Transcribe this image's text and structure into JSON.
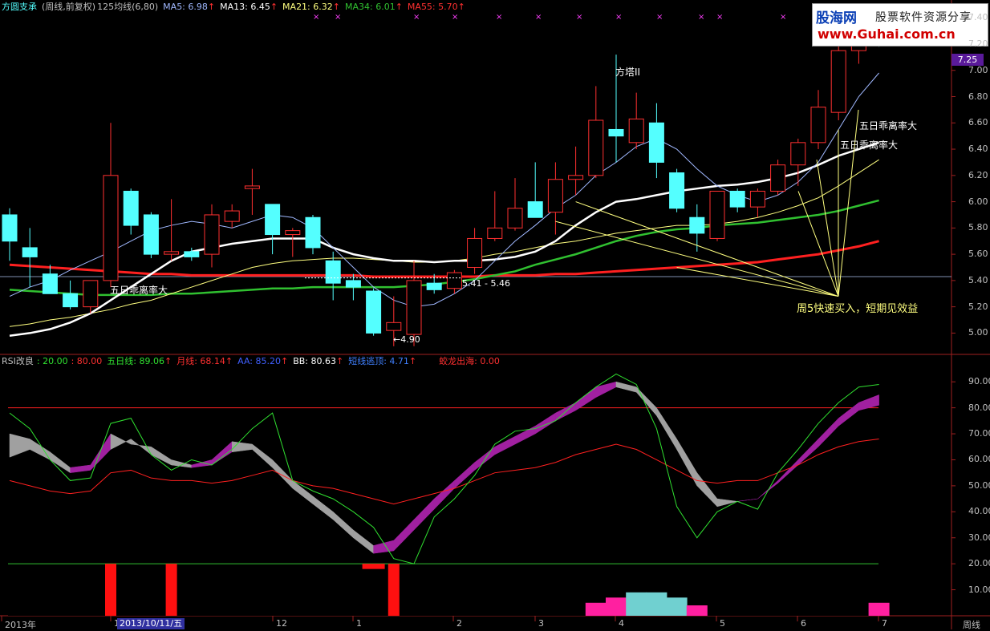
{
  "header": {
    "title": "方圆支承",
    "subtitle": "(周线,前复权)",
    "cost_line": "125均线(6,80)",
    "ma5": "MA5: 6.98",
    "ma13": "MA13: 6.45",
    "ma21": "MA21: 6.32",
    "ma34": "MA34: 6.01",
    "ma55": "MA55: 5.70"
  },
  "indicator_header": {
    "name": "RSI改良",
    "v1": ": 20.00",
    "v2": ": 80.00",
    "wuri": "五日线: 89.06",
    "yue": "月线: 68.14",
    "aa": "AA: 85.20",
    "bb": "BB: 80.63",
    "duan": "短线逃顶: 4.71",
    "jiaolong": "蛟龙出海: 0.00"
  },
  "logo": {
    "brand": "股海网",
    "slogan": "股票软件资源分享",
    "url": "www.Guhai.com.cn"
  },
  "colors": {
    "up": "#ff3030",
    "down": "#54ffff",
    "ma5": "#a0b8ff",
    "ma13": "#ffffff",
    "ma21": "#ffff80",
    "ma34": "#30c030",
    "ma55": "#ff2020"
  },
  "price_axis": [
    "7.40",
    "7.20",
    "7.00",
    "6.80",
    "6.60",
    "6.40",
    "6.20",
    "6.00",
    "5.80",
    "5.60",
    "5.40",
    "5.20",
    "5.00"
  ],
  "indicator_axis": [
    "90.00",
    "80.00",
    "70.00",
    "60.00",
    "50.00",
    "40.00",
    "30.00",
    "20.00",
    "10.00"
  ],
  "current_price": "7.25",
  "time_axis": {
    "labels": [
      "2013年",
      "1",
      "12",
      "1",
      "2",
      "3",
      "4",
      "5",
      "6",
      "7"
    ],
    "selected_date": "2013/10/11/五",
    "period": "周线"
  },
  "annotations": {
    "fangta": "方塔II",
    "wuri_left": "五日乖离率大",
    "wuri_right1": "五日乖离率大",
    "wuri_right2": "五日乖离率大",
    "low_price": "←4.90",
    "range_label": "5.41 - 5.46",
    "buy_signal": "周5快速买入，短期见效益"
  },
  "chart_data": {
    "type": "candlestick",
    "candles": [
      {
        "o": 5.9,
        "h": 5.95,
        "l": 5.55,
        "c": 5.7
      },
      {
        "o": 5.65,
        "h": 5.8,
        "l": 5.35,
        "c": 5.58
      },
      {
        "o": 5.45,
        "h": 5.52,
        "l": 5.3,
        "c": 5.3
      },
      {
        "o": 5.3,
        "h": 5.4,
        "l": 5.18,
        "c": 5.2
      },
      {
        "o": 5.2,
        "h": 5.4,
        "l": 5.15,
        "c": 5.4
      },
      {
        "o": 5.4,
        "h": 6.6,
        "l": 5.35,
        "c": 6.2
      },
      {
        "o": 6.08,
        "h": 6.1,
        "l": 5.75,
        "c": 5.82
      },
      {
        "o": 5.9,
        "h": 5.92,
        "l": 5.57,
        "c": 5.6
      },
      {
        "o": 5.6,
        "h": 6.02,
        "l": 5.55,
        "c": 5.62
      },
      {
        "o": 5.62,
        "h": 5.65,
        "l": 5.55,
        "c": 5.58
      },
      {
        "o": 5.6,
        "h": 5.98,
        "l": 5.5,
        "c": 5.9
      },
      {
        "o": 5.85,
        "h": 5.98,
        "l": 5.8,
        "c": 5.93
      },
      {
        "o": 6.1,
        "h": 6.25,
        "l": 5.9,
        "c": 6.12
      },
      {
        "o": 5.98,
        "h": 5.98,
        "l": 5.6,
        "c": 5.75
      },
      {
        "o": 5.75,
        "h": 5.8,
        "l": 5.58,
        "c": 5.78
      },
      {
        "o": 5.88,
        "h": 5.9,
        "l": 5.6,
        "c": 5.65
      },
      {
        "o": 5.55,
        "h": 5.62,
        "l": 5.25,
        "c": 5.38
      },
      {
        "o": 5.4,
        "h": 5.45,
        "l": 5.25,
        "c": 5.35
      },
      {
        "o": 5.32,
        "h": 5.34,
        "l": 4.98,
        "c": 5.0
      },
      {
        "o": 5.02,
        "h": 5.28,
        "l": 4.9,
        "c": 5.08
      },
      {
        "o": 4.99,
        "h": 5.55,
        "l": 4.9,
        "c": 5.4
      },
      {
        "o": 5.38,
        "h": 5.45,
        "l": 5.3,
        "c": 5.33
      },
      {
        "o": 5.34,
        "h": 5.48,
        "l": 5.3,
        "c": 5.46
      },
      {
        "o": 5.5,
        "h": 5.8,
        "l": 5.45,
        "c": 5.72
      },
      {
        "o": 5.72,
        "h": 6.08,
        "l": 5.7,
        "c": 5.8
      },
      {
        "o": 5.8,
        "h": 6.18,
        "l": 5.78,
        "c": 5.95
      },
      {
        "o": 6.0,
        "h": 6.3,
        "l": 5.95,
        "c": 5.88
      },
      {
        "o": 5.92,
        "h": 6.3,
        "l": 5.75,
        "c": 6.17
      },
      {
        "o": 6.17,
        "h": 6.42,
        "l": 6.05,
        "c": 6.2
      },
      {
        "o": 6.2,
        "h": 6.88,
        "l": 6.18,
        "c": 6.62
      },
      {
        "o": 6.55,
        "h": 7.12,
        "l": 6.3,
        "c": 6.5
      },
      {
        "o": 6.45,
        "h": 6.83,
        "l": 6.4,
        "c": 6.63
      },
      {
        "o": 6.6,
        "h": 6.75,
        "l": 6.18,
        "c": 6.3
      },
      {
        "o": 6.22,
        "h": 6.25,
        "l": 5.92,
        "c": 5.95
      },
      {
        "o": 5.88,
        "h": 5.98,
        "l": 5.62,
        "c": 5.76
      },
      {
        "o": 5.72,
        "h": 6.08,
        "l": 5.7,
        "c": 6.08
      },
      {
        "o": 6.08,
        "h": 6.1,
        "l": 5.92,
        "c": 5.96
      },
      {
        "o": 5.96,
        "h": 6.1,
        "l": 5.88,
        "c": 6.08
      },
      {
        "o": 6.08,
        "h": 6.32,
        "l": 6.05,
        "c": 6.28
      },
      {
        "o": 6.28,
        "h": 6.48,
        "l": 6.12,
        "c": 6.45
      },
      {
        "o": 6.45,
        "h": 6.85,
        "l": 6.4,
        "c": 6.72
      },
      {
        "o": 6.68,
        "h": 7.28,
        "l": 6.62,
        "c": 7.15
      },
      {
        "o": 7.15,
        "h": 7.42,
        "l": 7.05,
        "c": 7.4
      },
      {
        "o": 7.32,
        "h": 7.5,
        "l": 7.18,
        "c": 7.2
      }
    ],
    "ma5": [
      5.28,
      5.35,
      5.4,
      5.48,
      5.55,
      5.62,
      5.7,
      5.78,
      5.82,
      5.85,
      5.83,
      5.8,
      5.85,
      5.9,
      5.88,
      5.8,
      5.65,
      5.5,
      5.35,
      5.25,
      5.2,
      5.22,
      5.3,
      5.4,
      5.55,
      5.7,
      5.82,
      5.95,
      6.05,
      6.2,
      6.3,
      6.42,
      6.48,
      6.4,
      6.25,
      6.12,
      6.05,
      6.0,
      6.05,
      6.15,
      6.3,
      6.55,
      6.8,
      6.98
    ],
    "ma13": [
      4.98,
      5.0,
      5.03,
      5.08,
      5.15,
      5.25,
      5.35,
      5.45,
      5.55,
      5.62,
      5.65,
      5.68,
      5.7,
      5.72,
      5.72,
      5.72,
      5.65,
      5.6,
      5.57,
      5.55,
      5.55,
      5.54,
      5.55,
      5.55,
      5.56,
      5.58,
      5.62,
      5.7,
      5.82,
      5.92,
      6.0,
      6.02,
      6.05,
      6.08,
      6.1,
      6.12,
      6.13,
      6.15,
      6.18,
      6.22,
      6.28,
      6.35,
      6.4,
      6.45
    ],
    "ma21": [
      5.05,
      5.07,
      5.1,
      5.12,
      5.15,
      5.18,
      5.22,
      5.25,
      5.3,
      5.35,
      5.4,
      5.45,
      5.5,
      5.53,
      5.55,
      5.56,
      5.57,
      5.57,
      5.56,
      5.55,
      5.54,
      5.54,
      5.55,
      5.57,
      5.6,
      5.62,
      5.65,
      5.68,
      5.7,
      5.73,
      5.76,
      5.78,
      5.8,
      5.82,
      5.82,
      5.83,
      5.85,
      5.88,
      5.92,
      5.97,
      6.03,
      6.12,
      6.22,
      6.32
    ],
    "ma34": [
      5.33,
      5.32,
      5.31,
      5.3,
      5.29,
      5.29,
      5.29,
      5.29,
      5.3,
      5.3,
      5.31,
      5.32,
      5.33,
      5.34,
      5.34,
      5.35,
      5.35,
      5.35,
      5.35,
      5.35,
      5.36,
      5.37,
      5.39,
      5.41,
      5.44,
      5.47,
      5.52,
      5.56,
      5.6,
      5.65,
      5.7,
      5.74,
      5.77,
      5.79,
      5.8,
      5.82,
      5.83,
      5.84,
      5.86,
      5.88,
      5.9,
      5.93,
      5.97,
      6.01
    ],
    "ma55": [
      5.52,
      5.51,
      5.5,
      5.49,
      5.48,
      5.47,
      5.46,
      5.45,
      5.45,
      5.44,
      5.44,
      5.44,
      5.44,
      5.44,
      5.44,
      5.44,
      5.44,
      5.44,
      5.43,
      5.43,
      5.43,
      5.43,
      5.43,
      5.43,
      5.44,
      5.44,
      5.44,
      5.45,
      5.45,
      5.46,
      5.47,
      5.48,
      5.49,
      5.5,
      5.51,
      5.52,
      5.53,
      5.54,
      5.56,
      5.58,
      5.6,
      5.63,
      5.66,
      5.7
    ],
    "rsi_wuri": [
      78,
      72,
      60,
      52,
      53,
      74,
      76,
      62,
      56,
      60,
      58,
      64,
      72,
      78,
      52,
      48,
      45,
      40,
      34,
      22,
      20,
      38,
      45,
      54,
      66,
      71,
      72,
      75,
      82,
      88,
      93,
      89,
      72,
      42,
      30,
      40,
      44,
      41,
      55,
      64,
      74,
      82,
      88,
      89
    ],
    "rsi_yue": [
      52,
      50,
      48,
      47,
      48,
      55,
      56,
      53,
      52,
      52,
      51,
      52,
      54,
      56,
      52,
      50,
      49,
      47,
      45,
      43,
      45,
      47,
      49,
      52,
      55,
      56,
      57,
      59,
      62,
      64,
      66,
      64,
      60,
      56,
      52,
      51,
      52,
      52,
      55,
      58,
      62,
      65,
      67,
      68
    ],
    "band_upper": [
      70,
      68,
      63,
      57,
      58,
      70,
      66,
      65,
      60,
      58,
      60,
      67,
      66,
      60,
      52,
      46,
      40,
      33,
      27,
      29,
      37,
      45,
      52,
      59,
      65,
      69,
      73,
      78,
      82,
      88,
      90,
      88,
      80,
      68,
      55,
      45,
      44,
      45,
      52,
      60,
      68,
      76,
      82,
      85
    ],
    "band_lower": [
      61,
      64,
      60,
      55,
      56,
      64,
      68,
      62,
      58,
      57,
      58,
      63,
      64,
      57,
      49,
      43,
      37,
      30,
      24,
      25,
      33,
      41,
      49,
      56,
      62,
      66,
      70,
      75,
      79,
      84,
      88,
      86,
      77,
      64,
      50,
      42,
      44,
      45,
      51,
      58,
      65,
      73,
      79,
      81
    ],
    "jiaolong_bars": [
      0,
      0,
      0,
      0,
      0,
      20,
      0,
      0,
      20,
      0,
      0,
      0,
      0,
      0,
      0,
      0,
      0,
      0,
      0,
      20,
      0,
      0,
      0,
      0,
      0,
      0,
      0,
      0,
      0,
      0,
      0,
      0,
      0,
      0,
      0,
      0,
      0,
      0,
      0,
      0,
      0,
      0,
      0,
      0
    ],
    "duan_bars": [
      0,
      0,
      0,
      0,
      0,
      0,
      0,
      0,
      0,
      0,
      0,
      0,
      0,
      0,
      0,
      0,
      0,
      0,
      0,
      0,
      0,
      0,
      0,
      0,
      0,
      0,
      0,
      0,
      0,
      5,
      7,
      9,
      9,
      7,
      4,
      0,
      0,
      0,
      0,
      0,
      0,
      0,
      0,
      5
    ],
    "ylim_price": [
      4.85,
      7.45
    ],
    "ylim_indicator": [
      0,
      95
    ]
  }
}
